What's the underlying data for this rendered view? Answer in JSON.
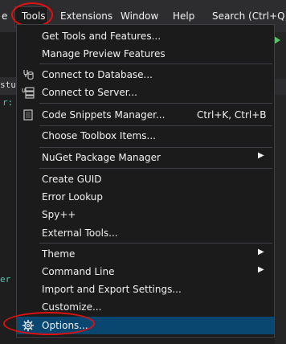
{
  "menubar": {
    "partial_left": "e",
    "tools": "Tools",
    "extensions": "Extensions",
    "window": "Window",
    "help": "Help",
    "search": "Search (Ctrl+Q)"
  },
  "editor": {
    "tab_fragment": "stu",
    "code_fragment_1": "r:",
    "code_fragment_2": "er"
  },
  "menu": {
    "get_tools": "Get Tools and Features...",
    "manage_preview": "Manage Preview Features",
    "connect_db": "Connect to Database...",
    "connect_server": "Connect to Server...",
    "code_snippets": "Code Snippets Manager...",
    "code_snippets_shortcut": "Ctrl+K, Ctrl+B",
    "choose_toolbox": "Choose Toolbox Items...",
    "nuget": "NuGet Package Manager",
    "create_guid": "Create GUID",
    "error_lookup": "Error Lookup",
    "spy": "Spy++",
    "external_tools": "External Tools...",
    "theme": "Theme",
    "command_line": "Command Line",
    "import_export": "Import and Export Settings...",
    "customize": "Customize...",
    "options": "Options..."
  },
  "icons": {
    "submenu": "submenu-arrow-icon",
    "database": "database-connect-icon",
    "server": "server-connect-icon",
    "snippet": "code-snippet-icon",
    "gear": "gear-icon"
  },
  "colors": {
    "menu_bg": "#1b1b1c",
    "selection": "#094771",
    "annotation": "#e01010"
  }
}
